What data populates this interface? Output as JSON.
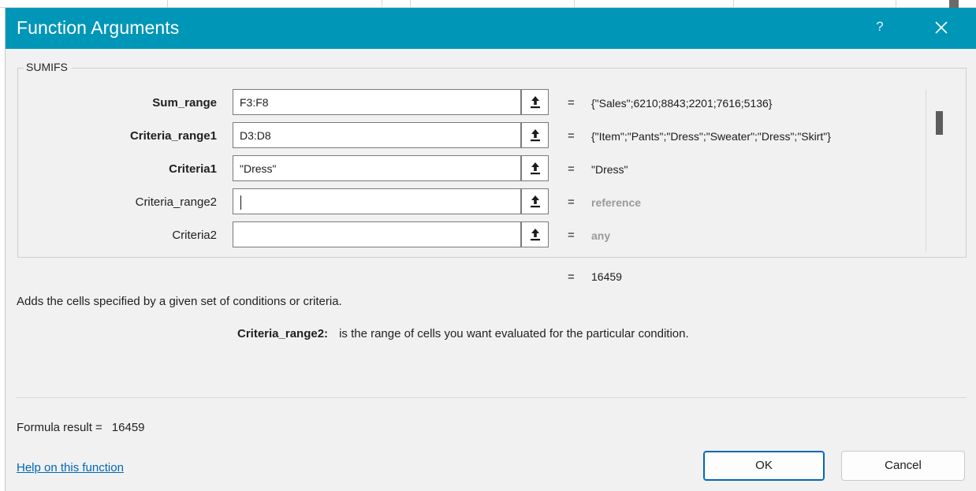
{
  "dialog": {
    "title": "Function Arguments",
    "help_label": "?",
    "accent_color": "#0096b7",
    "function_name": "SUMIFS"
  },
  "args": [
    {
      "label": "Sum_range",
      "bold": true,
      "value": "F3:F8",
      "evaluated": "{\"Sales\";6210;8843;2201;7616;5136}",
      "muted": false
    },
    {
      "label": "Criteria_range1",
      "bold": true,
      "value": "D3:D8",
      "evaluated": "{\"Item\";\"Pants\";\"Dress\";\"Sweater\";\"Dress\";\"Skirt\"}",
      "muted": false
    },
    {
      "label": "Criteria1",
      "bold": true,
      "value": "\"Dress\"",
      "evaluated": "\"Dress\"",
      "muted": false
    },
    {
      "label": "Criteria_range2",
      "bold": false,
      "value": "",
      "evaluated": "reference",
      "muted": true
    },
    {
      "label": "Criteria2",
      "bold": false,
      "value": "",
      "evaluated": "any",
      "muted": true
    }
  ],
  "equals_sign": "=",
  "result_value": "16459",
  "description": "Adds the cells specified by a given set of conditions or criteria.",
  "arg_help": {
    "name": "Criteria_range2:",
    "text": "is the range of cells you want evaluated for the particular condition."
  },
  "formula_result": {
    "label": "Formula result =",
    "value": "16459"
  },
  "help_link": "Help on this function",
  "buttons": {
    "ok": "OK",
    "cancel": "Cancel"
  },
  "icons": {
    "close": "close-icon",
    "collapse": "collapse-dialog-icon"
  }
}
